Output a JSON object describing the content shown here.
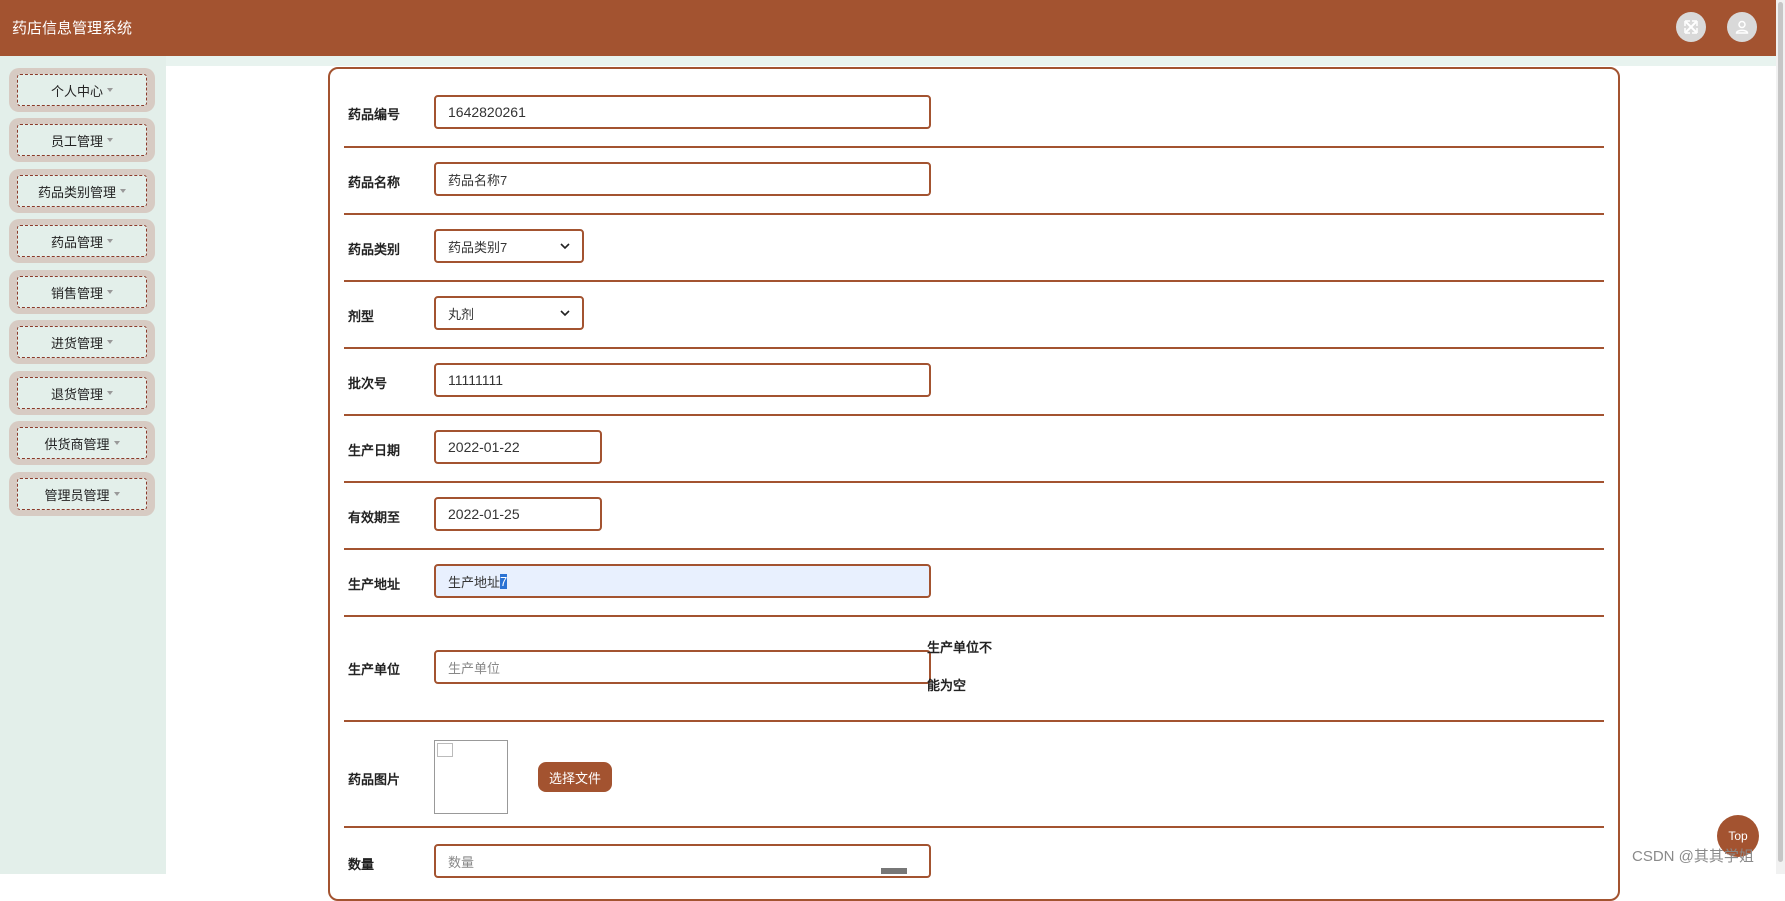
{
  "header": {
    "title": "药店信息管理系统",
    "fullscreen_icon": "expand-icon",
    "user_icon": "user-icon",
    "bg_color": "#a35330"
  },
  "sidebar": {
    "items": [
      {
        "label": "个人中心"
      },
      {
        "label": "员工管理"
      },
      {
        "label": "药品类别管理"
      },
      {
        "label": "药品管理"
      },
      {
        "label": "销售管理"
      },
      {
        "label": "进货管理"
      },
      {
        "label": "退货管理"
      },
      {
        "label": "供货商管理"
      },
      {
        "label": "管理员管理"
      }
    ]
  },
  "form": {
    "drug_no": {
      "label": "药品编号",
      "value": "1642820261"
    },
    "drug_name": {
      "label": "药品名称",
      "value": "药品名称7"
    },
    "drug_category": {
      "label": "药品类别",
      "value": "药品类别7"
    },
    "dosage_form": {
      "label": "剂型",
      "value": "丸剂"
    },
    "batch_no": {
      "label": "批次号",
      "value": "11111111"
    },
    "production_date": {
      "label": "生产日期",
      "value": "2022-01-22"
    },
    "expiry_date": {
      "label": "有效期至",
      "value": "2022-01-25"
    },
    "production_address": {
      "label": "生产地址",
      "value_prefix": "生产地址",
      "value_selected": "7"
    },
    "manufacturer": {
      "label": "生产单位",
      "placeholder": "生产单位",
      "error_line1": "生产单位不",
      "error_line2": "能为空"
    },
    "drug_image": {
      "label": "药品图片",
      "button": "选择文件"
    },
    "quantity": {
      "label": "数量",
      "placeholder": "数量"
    }
  },
  "top_button": "Top",
  "watermark": "CSDN @其其学姐"
}
